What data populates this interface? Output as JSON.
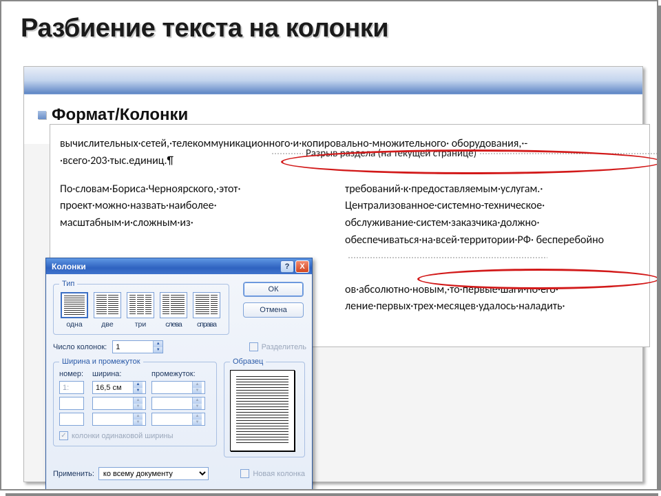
{
  "slide": {
    "title": "Разбиение текста на колонки",
    "bullet": "Формат/Колонки"
  },
  "doc": {
    "paragraph1": "вычислительных·сетей,·телекоммуникационного·и·копировально-множительного· оборудования,·-·всего·203·тыс.единиц.¶",
    "section_break_label": "Разрыв раздела (на текущей странице)",
    "colL": "По·словам·Бориса·Черноярского,·этот· проект·можно·назвать·наиболее· масштабным·и·сложным·из·",
    "colR_top": "требований·к·предоставляемым·услугам.· Централизованное·системно-техническое· обслуживание·систем·заказчика·должно· обеспечиваться·на·всей·территории·РФ· бесперебойно",
    "colR_bottom": "ов·абсолютно·новым,·то·первые·шаги·по·его· ление·первых·трех·месяцев·удалось·наладить·"
  },
  "dialog": {
    "title": "Колонки",
    "help": "?",
    "close": "X",
    "ok": "ОК",
    "cancel": "Отмена",
    "group_type": "Тип",
    "presets": {
      "one": "одна",
      "two": "две",
      "three": "три",
      "left": "слева",
      "right": "справа"
    },
    "num_columns_label": "Число колонок:",
    "num_columns_value": "1",
    "separator_label": "Разделитель",
    "group_width": "Ширина и промежуток",
    "col_hdr_num": "номер:",
    "col_hdr_width": "ширина:",
    "col_hdr_gap": "промежуток:",
    "row1_num": "1:",
    "row1_width": "16,5 см",
    "row1_gap": "",
    "equal_checkbox": "колонки одинаковой ширины",
    "group_sample": "Образец",
    "new_column_label": "Новая колонка",
    "apply_label": "Применить:",
    "apply_value": "ко всему документу"
  }
}
